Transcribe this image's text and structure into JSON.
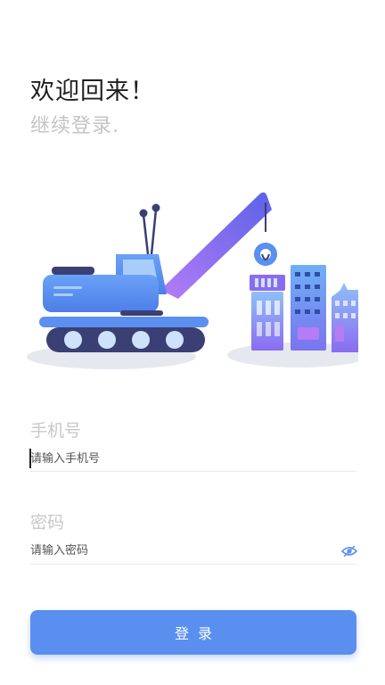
{
  "header": {
    "title": "欢迎回来！",
    "subtitle": "继续登录."
  },
  "illustration": {
    "icon": "crane-truck-city-illustration",
    "colors": {
      "truck_body": "#5b8ff0",
      "crane_arm": "#8a6cf0",
      "track": "#3a3f74",
      "building": "#7c7ef2",
      "shadow": "#e6e8ef"
    }
  },
  "form": {
    "phone_label": "手机号",
    "phone_placeholder": "请输入手机号",
    "password_label": "密码",
    "password_placeholder": "请输入密码",
    "password_toggle_icon": "eye-icon"
  },
  "actions": {
    "login_label": "登录"
  },
  "theme": {
    "accent": "#5a8ff0"
  }
}
